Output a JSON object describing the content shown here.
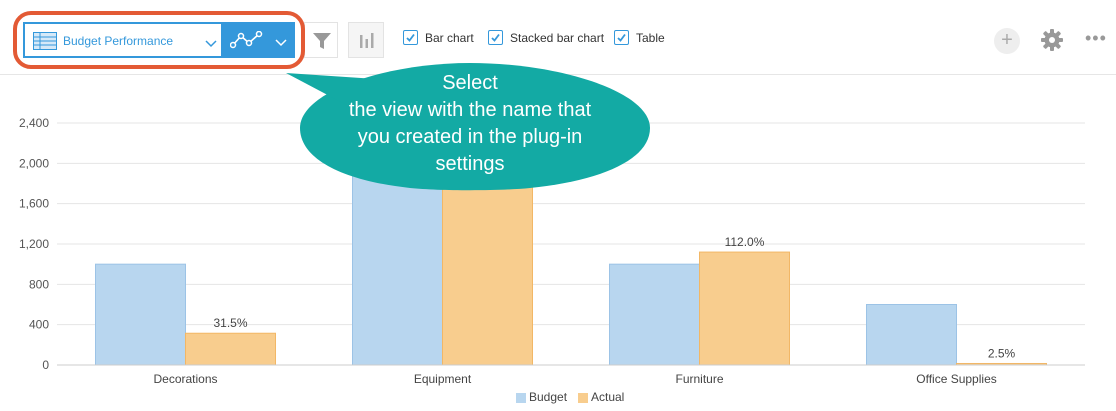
{
  "toolbar": {
    "view_label": "Budget Performance",
    "checkboxes": [
      {
        "label": "Bar chart",
        "checked": true
      },
      {
        "label": "Stacked bar chart",
        "checked": true
      },
      {
        "label": "Table",
        "checked": true
      }
    ],
    "add_label": "+",
    "more_label": "•••"
  },
  "callout": {
    "lines": [
      "Select",
      "the view with the name that",
      "you created in the plug-in",
      "settings"
    ],
    "color": "#13aaa4",
    "highlight_color": "#e35a35"
  },
  "colors": {
    "accent": "#3498db",
    "budget": "#b8d6ef",
    "actual": "#f8cd8e"
  },
  "chart_data": {
    "type": "bar",
    "categories": [
      "Decorations",
      "Equipment",
      "Furniture",
      "Office Supplies"
    ],
    "series": [
      {
        "name": "Budget",
        "values": [
          1000,
          2000,
          1000,
          600
        ]
      },
      {
        "name": "Actual",
        "values": [
          315,
          2000,
          1120,
          15
        ]
      }
    ],
    "data_labels": [
      "31.5%",
      "",
      "112.0%",
      "2.5%"
    ],
    "ylim": [
      0,
      2400
    ],
    "yticks": [
      "0",
      "400",
      "800",
      "1,200",
      "1,600",
      "2,000",
      "2,400"
    ],
    "grid": true,
    "legend_position": "bottom"
  }
}
